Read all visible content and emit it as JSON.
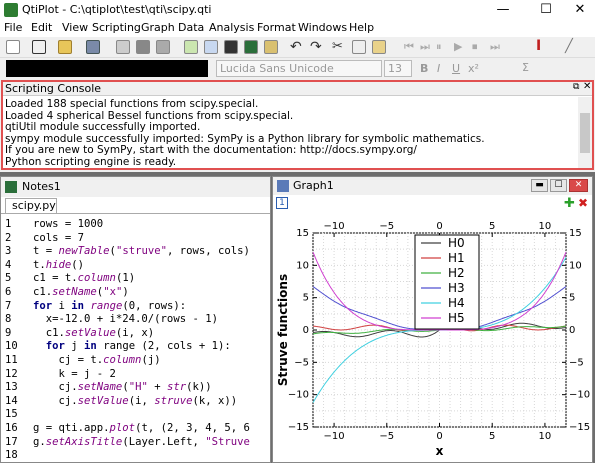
{
  "app": {
    "title": "QtiPlot - C:\\qtiplot\\test\\qti\\scipy.qti",
    "minimize": "—",
    "maximize": "☐",
    "close": "✕"
  },
  "menu": [
    "File",
    "Edit",
    "View",
    "Scripting",
    "Graph",
    "Data",
    "Analysis",
    "Format",
    "Windows",
    "Help"
  ],
  "toolbar": {
    "font_name": "Lucida Sans Unicode",
    "font_size": "13",
    "bold": "B",
    "italic": "I",
    "underline": "U",
    "superscript": "x²",
    "sigma": "Σ"
  },
  "console": {
    "title": "Scripting Console",
    "lines": [
      "Loaded 188 special functions from scipy.special.",
      "Loaded 4 spherical Bessel functions from scipy.special.",
      "qtiUtil module successfully imported.",
      "sympy module successfully imported: SymPy is a Python library for symbolic mathematics.",
      "If you are new to SymPy, start with the documentation: http://docs.sympy.org/",
      "Python scripting engine is ready."
    ]
  },
  "notes": {
    "title": "Notes1",
    "tab": "scipy.py",
    "line_numbers": [
      "1",
      "2",
      "3",
      "4",
      "5",
      "6",
      "7",
      "8",
      "9",
      "10",
      "11",
      "12",
      "13",
      "14",
      "15",
      "16",
      "17",
      "18"
    ],
    "code_text": [
      "rows = 1000",
      "cols = 7",
      "t = newTable(\"struve\", rows, cols)",
      "t.hide()",
      "c1 = t.column(1)",
      "c1.setName(\"x\")",
      "for i in range(0, rows):",
      "  x=-12.0 + i*24.0/(rows - 1)",
      "  c1.setValue(i, x)",
      "  for j in range (2, cols + 1):",
      "    cj = t.column(j)",
      "    k = j - 2",
      "    cj.setName(\"H\" + str(k))",
      "    cj.setValue(i, struve(k, x))",
      "",
      "g = qti.app.plot(t, (2, 3, 4, 5, 6",
      "g.setAxisTitle(Layer.Left, \"Struve",
      ""
    ]
  },
  "graph": {
    "title": "Graph1",
    "layer": "1"
  },
  "chart_data": {
    "type": "line",
    "xlabel": "x",
    "ylabel": "Struve functions",
    "xlim": [
      -12,
      12
    ],
    "ylim": [
      -15,
      15
    ],
    "xticks": [
      -10,
      -5,
      0,
      5,
      10
    ],
    "yticks": [
      -15,
      -10,
      -5,
      0,
      5,
      10,
      15
    ],
    "grid": true,
    "legend_position": "top-center",
    "series": [
      {
        "name": "H0",
        "color": "#404040",
        "order": 0
      },
      {
        "name": "H1",
        "color": "#d04040",
        "order": 1
      },
      {
        "name": "H2",
        "color": "#40b040",
        "order": 2
      },
      {
        "name": "H3",
        "color": "#5050d0",
        "order": 3
      },
      {
        "name": "H4",
        "color": "#40d0e0",
        "order": 4
      },
      {
        "name": "H5",
        "color": "#d040d0",
        "order": 5
      }
    ]
  }
}
